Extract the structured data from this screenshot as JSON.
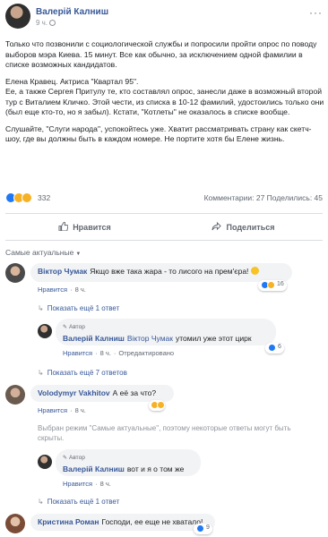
{
  "post": {
    "author": "Валерій Калниш",
    "time": "9 ч.",
    "more": "···",
    "paragraphs": [
      "Только что позвонили с социологической службы и попросили пройти опрос по поводу выборов мэра Киева. 15 минут. Все как обычно, за исключением одной фамилии в списке возможных кандидатов.",
      "Елена Кравец. Актриса \"Квартал 95\".\nЕе, а также Сергея Притулу те, кто составлял опрос, занесли даже в возможный второй тур с Виталием Кличко. Этой чести, из списка в 10-12 фамилий, удостоились только они (был еще кто-то, но я забыл). Кстати, \"Котлеты\" не оказалось в списке вообще.",
      "Слушайте, \"Слуги народа\", успокойтесь уже. Хватит рассматривать страну как скетч-шоу, где вы должны быть в каждом номере. Не портите хотя бы Елене жизнь."
    ],
    "reaction_count": "332",
    "stats": "Комментарии: 27  Поделились: 45"
  },
  "actions": {
    "like": "Нравится",
    "share": "Поделиться"
  },
  "comments": {
    "sort_label": "Самые актуальные",
    "items": [
      {
        "name": "Віктор Чумак",
        "text": "Якщо вже така жара - то лисого на прем'єра!",
        "like": "Нравится",
        "time": "8 ч.",
        "reactions": "16",
        "replies_link": "Показать ещё 1 ответ"
      },
      {
        "author_tag": "Автор",
        "name": "Валерій Калниш",
        "mention": "Віктор Чумак",
        "text": "утомил уже этот цирк",
        "like": "Нравится",
        "time": "8 ч.",
        "edited": "Отредактировано",
        "reactions": "6"
      },
      {
        "replies_link": "Показать ещё 7 ответов"
      },
      {
        "name": "Volodymyr Vakhitov",
        "text": "А её за что?",
        "like": "Нравится",
        "time": "8 ч."
      },
      {
        "notice": "Выбран режим \"Самые актуальные\", поэтому некоторые ответы могут быть скрыты."
      },
      {
        "author_tag": "Автор",
        "name": "Валерій Калниш",
        "text": "вот и я о том же",
        "like": "Нравится",
        "time": "8 ч.",
        "replies_link": "Показать ещё 1 ответ"
      },
      {
        "name": "Кристина Роман",
        "text": "Господи, ее еще не хватало!",
        "reactions": "9"
      }
    ]
  }
}
